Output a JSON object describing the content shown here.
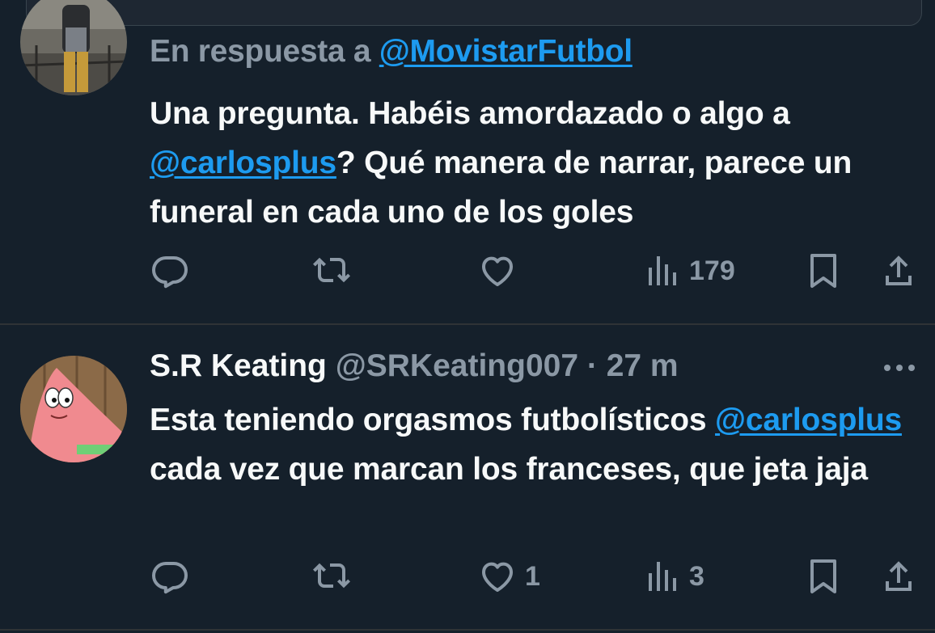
{
  "tweet1": {
    "reply_prefix": "En respuesta a ",
    "reply_to": "@MovistarFutbol",
    "text_part1": "Una pregunta. Habéis amordazado o algo a ",
    "mention": "@carlosplus",
    "text_part2": "? Qué manera de narrar, parece un funeral en cada uno de los goles",
    "views": "179"
  },
  "tweet2": {
    "author_name": "S.R Keating",
    "handle": "@SRKeating007",
    "separator": " · ",
    "time": "27 m",
    "text_part1": "Esta teniendo orgasmos futbolísticos ",
    "mention": "@carlosplus",
    "text_part2": " cada vez que marcan los franceses, que jeta jaja",
    "likes": "1",
    "views": "3"
  },
  "icons": {
    "reply": "reply-icon",
    "retweet": "retweet-icon",
    "like": "heart-icon",
    "views": "views-chart-icon",
    "bookmark": "bookmark-icon",
    "share": "share-icon",
    "more": "more-dots-icon"
  },
  "colors": {
    "background": "#15202b",
    "text": "#f7f9f9",
    "muted": "#8b98a5",
    "link": "#1d9bf0"
  }
}
